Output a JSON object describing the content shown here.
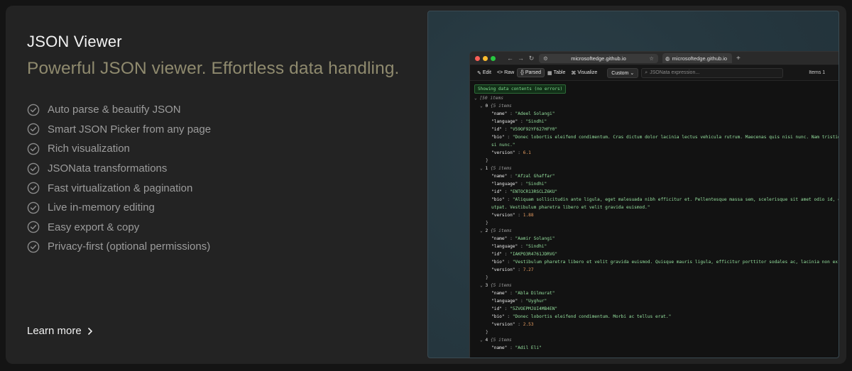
{
  "left": {
    "title": "JSON Viewer",
    "subtitle": "Powerful JSON viewer. Effortless data handling.",
    "features": [
      "Auto parse & beautify JSON",
      "Smart JSON Picker from any page",
      "Rich visualization",
      "JSONata transformations",
      "Fast virtualization & pagination",
      "Live in-memory editing",
      "Easy export & copy",
      "Privacy-first (optional permissions)"
    ],
    "learn_more": "Learn more"
  },
  "browser": {
    "url": "microsoftedge.github.io",
    "tab_title": "microsoftedge.github.io",
    "toolbar": {
      "edit": "Edit",
      "raw": "Raw",
      "parsed": "Parsed",
      "table": "Table",
      "visualize": "Visualize",
      "custom": "Custom",
      "jsonata_placeholder": "JSONata expression...",
      "items": "Items 1"
    },
    "status": "Showing data contents (no errors)",
    "root_label": "[50 items",
    "records": [
      {
        "index": "0",
        "count": "{5 items",
        "name": "\"Adeel Solangi\"",
        "language": "\"Sindhi\"",
        "id": "\"V59OF92YF627HFY0\"",
        "bio": [
          "\"Donec lobortis eleifend condimentum. Cras dictum dolor lacinia lectus vehicula rutrum. Maecenas quis nisi nunc. Nam tristique",
          "si nunc.\""
        ],
        "version": "6.1"
      },
      {
        "index": "1",
        "count": "{5 items",
        "name": "\"Afzal Ghaffar\"",
        "language": "\"Sindhi\"",
        "id": "\"ENTOCR13RSCLZ6KU\"",
        "bio": [
          "\"Aliquam sollicitudin ante ligula, eget malesuada nibh efficitur et. Pellentesque massa sem, scelerisque sit amet odio id, cu",
          "utpat. Vestibulum pharetra libero et velit gravida euismod.\""
        ],
        "version": "1.88"
      },
      {
        "index": "2",
        "count": "{5 items",
        "name": "\"Aamir Solangi\"",
        "language": "\"Sindhi\"",
        "id": "\"IAKPO3R4761JDRVG\"",
        "bio": [
          "\"Vestibulum pharetra libero et velit gravida euismod. Quisque mauris ligula, efficitur porttitor sodales ac, lacinia non ex."
        ],
        "version": "7.27"
      },
      {
        "index": "3",
        "count": "{5 items",
        "name": "\"Abla Dilmurat\"",
        "language": "\"Uyghur\"",
        "id": "\"5ZVOEPMJUI4MB4EN\"",
        "bio": [
          "\"Donec lobortis eleifend condimentum. Morbi ac tellus erat.\""
        ],
        "version": "2.53"
      },
      {
        "index": "4",
        "count": "{5 items",
        "name": "\"Adil Eli\""
      }
    ],
    "keys": {
      "name": "\"name\"",
      "language": "\"language\"",
      "id": "\"id\"",
      "bio": "\"bio\"",
      "version": "\"version\""
    },
    "close_brace": "}"
  },
  "colors": {
    "card_bg": "#232323",
    "subtitle": "#8f8a6e",
    "feature_text": "#9c9c9c",
    "string": "#95e09e",
    "number": "#e39a5f",
    "status_green": "#7fdc8e"
  }
}
